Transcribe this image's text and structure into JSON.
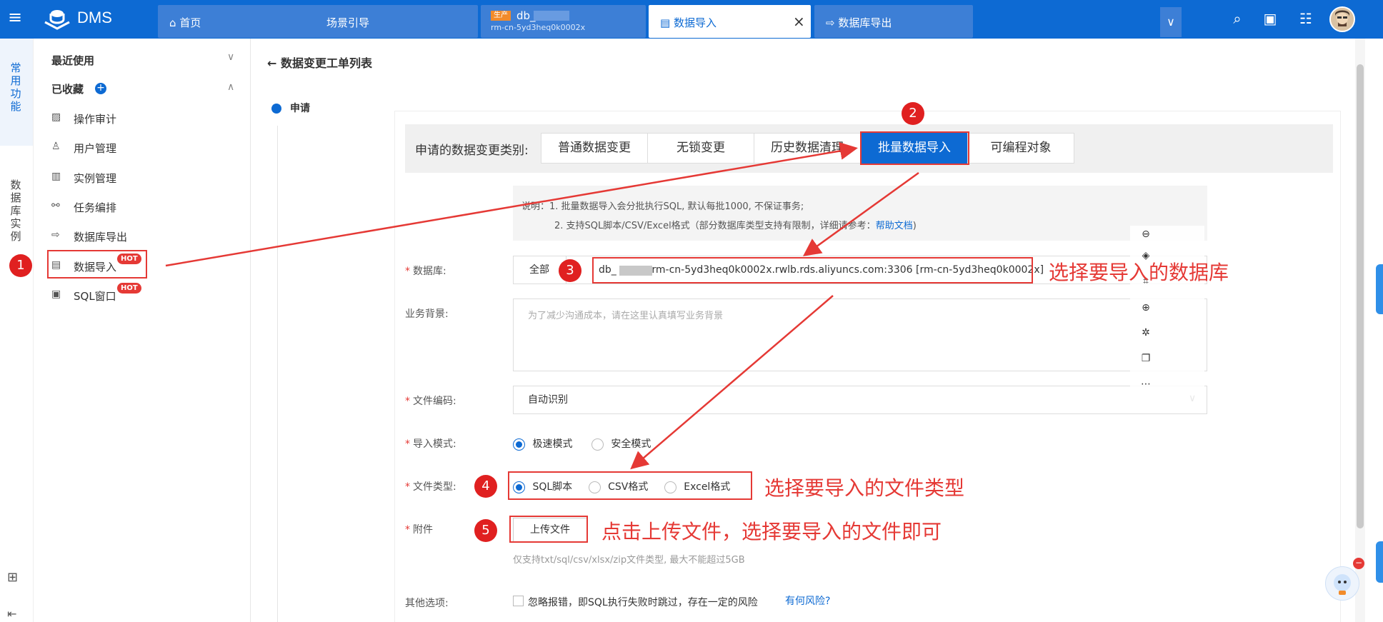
{
  "topbar": {
    "app_name": "DMS",
    "tabs": [
      {
        "label": "首页",
        "icon": "home-icon"
      },
      {
        "label": "场景引导"
      },
      {
        "env_tag": "生产",
        "label": "db_",
        "sublabel": "rm-cn-5yd3heq0k0002x"
      },
      {
        "label": "数据导入",
        "icon": "document-icon",
        "close": "×"
      },
      {
        "label": "数据库导出",
        "icon": "export-icon"
      }
    ],
    "more": "∨"
  },
  "rail": {
    "frequent": "常用功能",
    "db_instance": "数据库实例"
  },
  "sidebar": {
    "recent": "最近使用",
    "favorites": "已收藏",
    "items": [
      {
        "label": "操作审计",
        "icon": "audit-icon"
      },
      {
        "label": "用户管理",
        "icon": "user-icon"
      },
      {
        "label": "实例管理",
        "icon": "instance-icon"
      },
      {
        "label": "任务编排",
        "icon": "task-icon"
      },
      {
        "label": "数据库导出",
        "icon": "export-icon"
      },
      {
        "label": "数据导入",
        "icon": "import-icon",
        "badge": "HOT"
      },
      {
        "label": "SQL窗口",
        "icon": "sql-window-icon",
        "badge": "HOT"
      }
    ]
  },
  "main": {
    "back_title": "数据变更工单列表",
    "step": "申请",
    "category_label": "申请的数据变更类别:",
    "categories": [
      "普通数据变更",
      "无锁变更",
      "历史数据清理",
      "批量数据导入",
      "可编程对象"
    ],
    "note_line1": "说明：1. 批量数据导入会分批执行SQL, 默认每批1000, 不保证事务;",
    "note_line2": "2. 支持SQL脚本/CSV/Excel格式（部分数据库类型支持有限制，详细请参考：",
    "note_link": "帮助文档",
    "note_end": ")",
    "db_label": "数据库:",
    "db_scope": "全部",
    "db_value": "db_        @rm-cn-5yd3heq0k0002x.rwlb.rds.aliyuncs.com:3306 [rm-cn-5yd3heq0k0002x]",
    "bg_label": "业务背景:",
    "bg_placeholder": "为了减少沟通成本，请在这里认真填写业务背景",
    "encoding_label": "文件编码:",
    "encoding_value": "自动识别",
    "mode_label": "导入模式:",
    "mode_fast": "极速模式",
    "mode_safe": "安全模式",
    "filetype_label": "文件类型:",
    "filetype_sql": "SQL脚本",
    "filetype_csv": "CSV格式",
    "filetype_excel": "Excel格式",
    "attach_label": "附件",
    "upload_button": "上传文件",
    "upload_hint": "仅支持txt/sql/csv/xlsx/zip文件类型, 最大不能超过5GB",
    "other_label": "其他选项:",
    "ignore_error": "忽略报错，即SQL执行失败时跳过，存在一定的风险",
    "risk_link": "有何风险?"
  },
  "annotations": {
    "badges": [
      "1",
      "2",
      "3",
      "4",
      "5"
    ],
    "db_note": "选择要导入的数据库",
    "filetype_note": "选择要导入的文件类型",
    "upload_note": "点击上传文件，选择要导入的文件即可"
  }
}
